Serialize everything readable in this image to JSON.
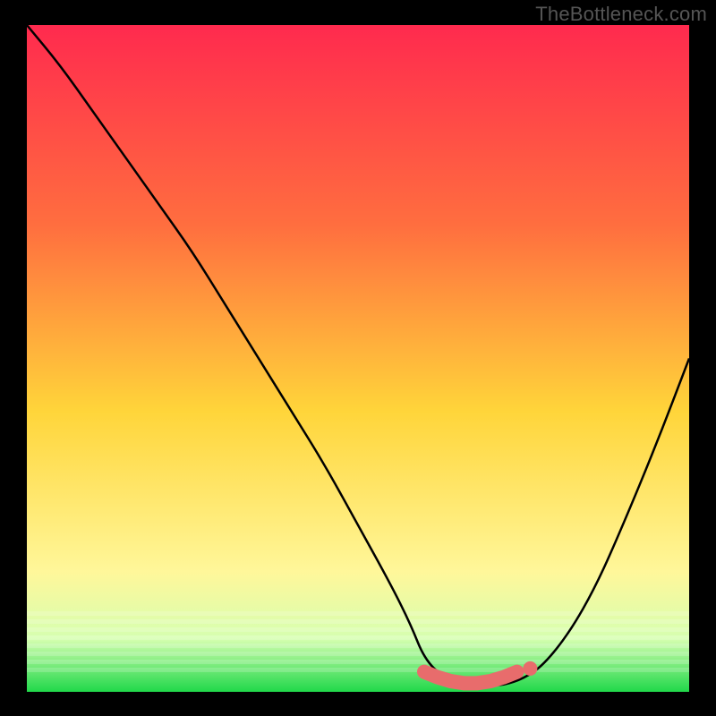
{
  "watermark": "TheBottleneck.com",
  "colors": {
    "background": "#000000",
    "grad_top": "#ff2a4e",
    "grad_mid1": "#ff6e3f",
    "grad_mid2": "#ffd53a",
    "grad_mid3": "#fff79a",
    "grad_low": "#d6ffb0",
    "grad_bottom": "#20d84a",
    "curve": "#000000",
    "marker_fill": "#e86c6c",
    "marker_stroke": "#cf4d4d"
  },
  "chart_data": {
    "type": "line",
    "title": "",
    "xlabel": "",
    "ylabel": "",
    "xlim": [
      0,
      100
    ],
    "ylim": [
      0,
      100
    ],
    "series": [
      {
        "name": "bottleneck-curve",
        "x": [
          0,
          5,
          10,
          15,
          20,
          25,
          30,
          35,
          40,
          45,
          50,
          55,
          58,
          60,
          63,
          66,
          70,
          72,
          75,
          78,
          82,
          86,
          90,
          95,
          100
        ],
        "y": [
          100,
          94,
          87,
          80,
          73,
          66,
          58,
          50,
          42,
          34,
          25,
          16,
          10,
          5,
          2,
          1,
          1,
          1,
          2,
          4,
          9,
          16,
          25,
          37,
          50
        ]
      }
    ],
    "markers": {
      "name": "optimal-range",
      "x": [
        60,
        62,
        64,
        66,
        68,
        70,
        72,
        74
      ],
      "y": [
        3.0,
        2.2,
        1.6,
        1.3,
        1.3,
        1.6,
        2.2,
        3.0
      ]
    }
  }
}
